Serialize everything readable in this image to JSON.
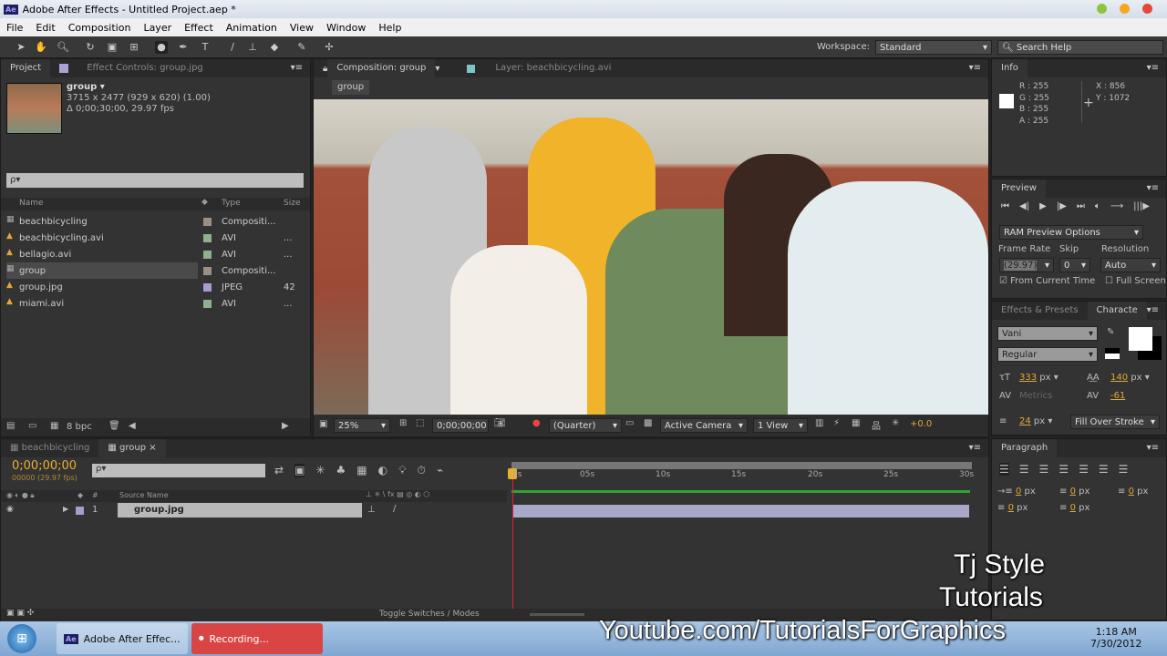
{
  "window": {
    "title": "Adobe After Effects - Untitled Project.aep *",
    "logo": "Ae"
  },
  "menu": [
    "File",
    "Edit",
    "Composition",
    "Layer",
    "Effect",
    "Animation",
    "View",
    "Window",
    "Help"
  ],
  "toolbar": {
    "workspace_label": "Workspace:",
    "workspace_value": "Standard",
    "search_placeholder": "Search Help"
  },
  "project": {
    "tab": "Project",
    "effect_tab": "Effect Controls: group.jpg",
    "item_name": "group ▾",
    "item_dims": "3715 x 2477  (929 x 620) (1.00)",
    "item_duration": "Δ 0;00;30;00, 29.97 fps",
    "search_placeholder": "ρ▾",
    "columns": {
      "name": "Name",
      "type": "Type",
      "size": "Size"
    },
    "items": [
      {
        "name": "beachbicycling",
        "type": "Compositi...",
        "size": "",
        "color": "#9a8f86"
      },
      {
        "name": "beachbicycling.avi",
        "type": "AVI",
        "size": "...",
        "color": "#8fb08f"
      },
      {
        "name": "bellagio.avi",
        "type": "AVI",
        "size": "...",
        "color": "#8fb08f"
      },
      {
        "name": "group",
        "type": "Compositi...",
        "size": "",
        "color": "#9a8f86"
      },
      {
        "name": "group.jpg",
        "type": "JPEG",
        "size": "42",
        "color": "#a89bd0"
      },
      {
        "name": "miami.avi",
        "type": "AVI",
        "size": "...",
        "color": "#8fb08f"
      }
    ],
    "bpc": "8 bpc"
  },
  "comp": {
    "tab": "Composition: group",
    "layer_tab": "Layer: beachbicycling.avi",
    "breadcrumb": "group",
    "zoom": "25%",
    "timecode": "0;00;00;00",
    "resolution": "(Quarter)",
    "camera": "Active Camera",
    "views": "1 View",
    "exposure": "+0.0"
  },
  "info": {
    "tab": "Info",
    "r": "R : 255",
    "g": "G : 255",
    "b": "B : 255",
    "a": "A : 255",
    "x": "X : 856",
    "y": "Y : 1072"
  },
  "preview": {
    "tab": "Preview",
    "ram": "RAM Preview Options",
    "frame_rate_label": "Frame Rate",
    "skip_label": "Skip",
    "resolution_label": "Resolution",
    "frame_rate": "(29.97)",
    "skip": "0",
    "resolution": "Auto",
    "from_current": "From Current Time",
    "full_screen": "Full Screen"
  },
  "character": {
    "effects_tab": "Effects & Presets",
    "tab": "Characte",
    "font": "Vani",
    "style": "Regular",
    "size": "333",
    "leading": "140",
    "kerning": "Metrics",
    "tracking": "-61",
    "stroke": "24",
    "stroke_mode": "Fill Over Stroke",
    "unit": "px"
  },
  "paragraph": {
    "tab": "Paragraph",
    "values": [
      "0",
      "0",
      "0",
      "0",
      "0"
    ],
    "unit": "px"
  },
  "timeline": {
    "tabs": [
      "beachbicycling",
      "group"
    ],
    "timecode": "0;00;00;00",
    "fps": "00000 (29.97 fps)",
    "search_placeholder": "ρ▾",
    "col_source": "Source Name",
    "layer_num": "1",
    "layer_name": "group.jpg",
    "toggle": "Toggle Switches / Modes",
    "ruler": [
      "0s",
      "05s",
      "10s",
      "15s",
      "20s",
      "25s",
      "30s"
    ]
  },
  "taskbar": {
    "ae": "Adobe After Effec...",
    "rec": "Recording...",
    "time": "1:18 AM",
    "date": "7/30/2012"
  },
  "watermark": {
    "line1": "Tj Style",
    "line2": "Tutorials",
    "line3": "Youtube.com/TutorialsForGraphics"
  }
}
